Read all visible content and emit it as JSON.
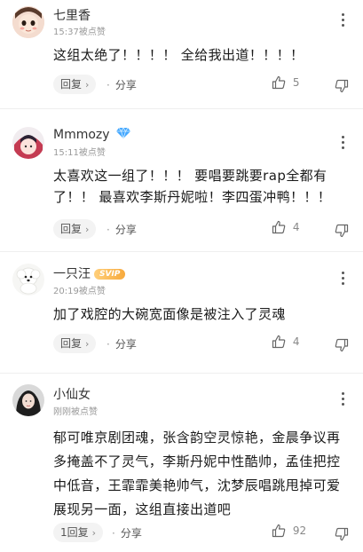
{
  "comments": [
    {
      "username": "七里香",
      "meta": "15:37被点赞",
      "text": "这组太绝了！！！！ 全给我出道！！！！",
      "reply_label": "回复",
      "share_label": "分享",
      "likes": "5"
    },
    {
      "username": "Mmmozy",
      "meta": "15:11被点赞",
      "text": "太喜欢这一组了！！！ 要唱要跳要rap全都有了！！ 最喜欢李斯丹妮啦！李四蛋冲鸭！！！",
      "reply_label": "回复",
      "share_label": "分享",
      "likes": "4"
    },
    {
      "username": "一只汪",
      "badge": "SVIP",
      "meta": "20:19被点赞",
      "text": "加了戏腔的大碗宽面像是被注入了灵魂",
      "reply_label": "回复",
      "share_label": "分享",
      "likes": "4"
    },
    {
      "username": "小仙女",
      "meta": "刚刚被点赞",
      "text": "郁可唯京剧团魂，张含韵空灵惊艳，金晨争议再多掩盖不了灵气，李斯丹妮中性酷帅，孟佳把控中低音，王霏霏美艳帅气，沈梦辰唱跳甩掉可爱展现另一面，这组直接出道吧",
      "reply_label": "1回复",
      "share_label": "分享",
      "likes": "92"
    }
  ],
  "icons": {
    "more": "more-vertical-icon",
    "like": "thumbs-up-icon",
    "dislike": "thumbs-down-icon",
    "diamond": "diamond-badge-icon"
  },
  "colors": {
    "diamond": "#3aa0ff",
    "svip": "#f7a93c"
  }
}
